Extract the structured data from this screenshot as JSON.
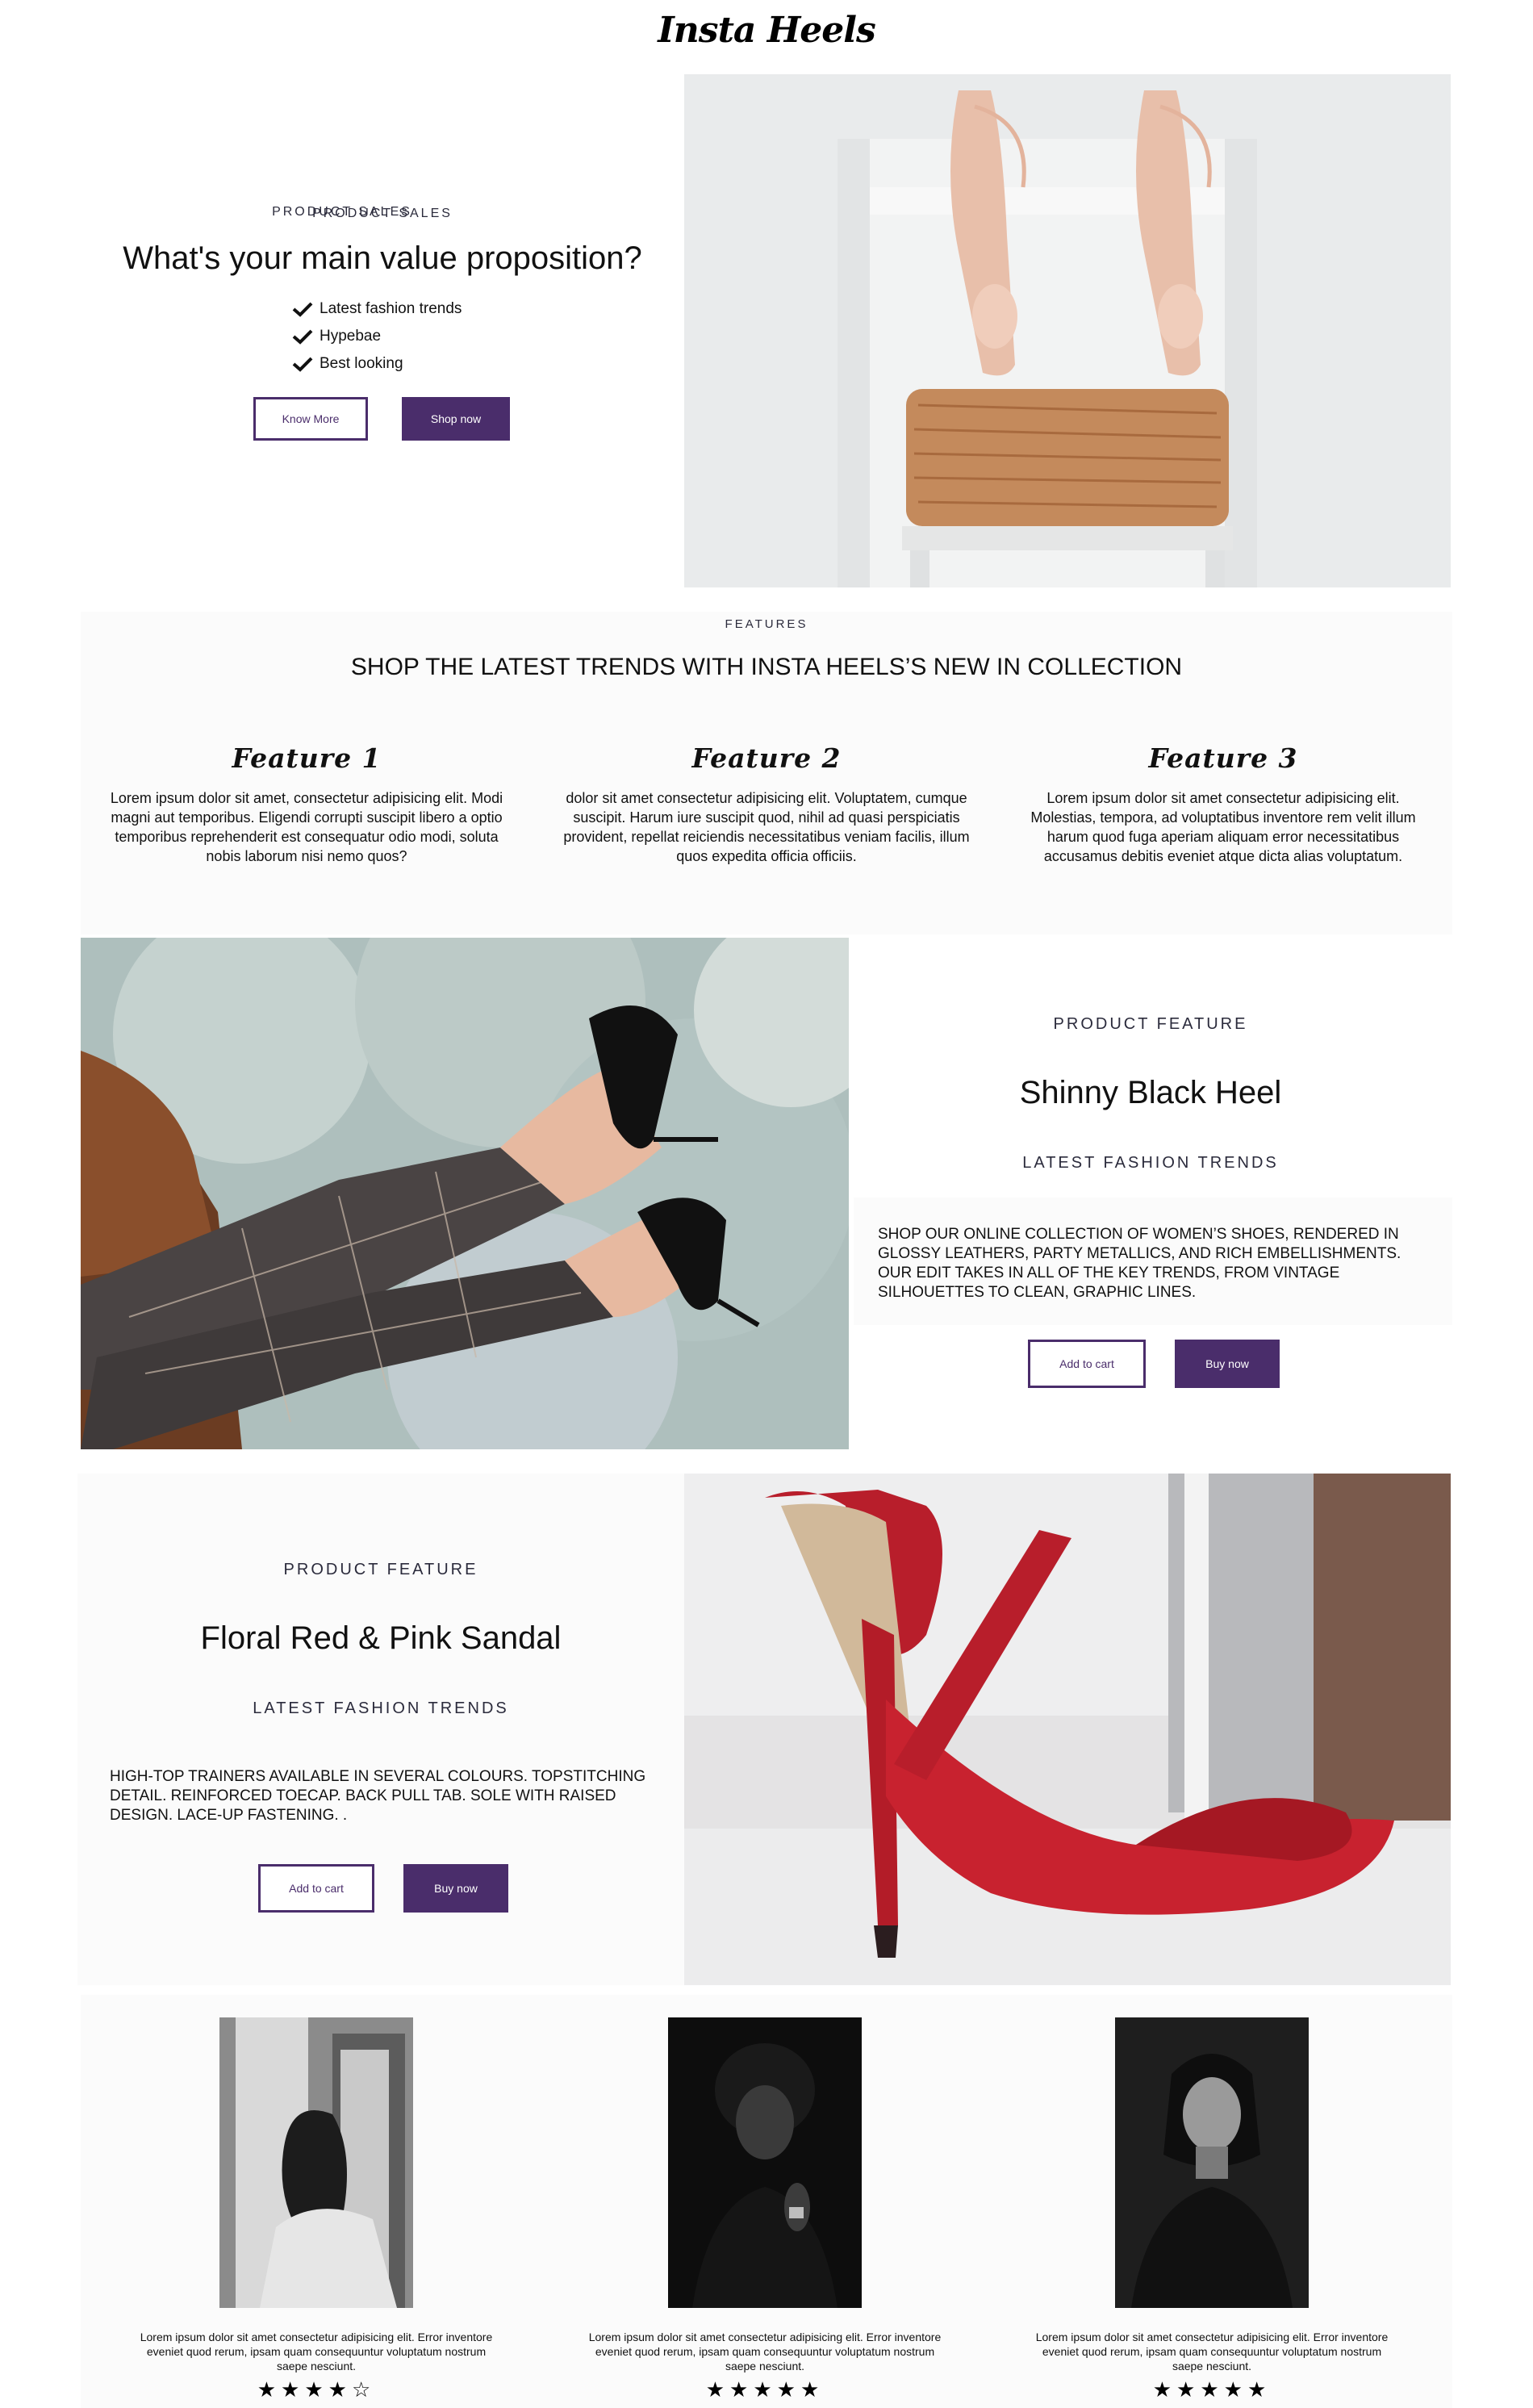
{
  "brand": "Insta Heels",
  "hero": {
    "eyebrow": "PRODUCT SALES",
    "title": "What's your main value proposition?",
    "bullets": [
      "Latest fashion trends",
      "Hypebae",
      "Best looking"
    ],
    "know_more": "Know More",
    "shop_now": "Shop now"
  },
  "features": {
    "eyebrow": "FEATURES",
    "title": "SHOP THE LATEST TRENDS WITH INSTA HEELS’S NEW IN COLLECTION",
    "items": [
      {
        "name": "Feature 1",
        "text": "Lorem ipsum dolor sit amet, consectetur adipisicing elit. Modi magni aut temporibus. Eligendi corrupti suscipit libero a optio temporibus reprehenderit est consequatur odio modi, soluta nobis laborum nisi nemo quos?"
      },
      {
        "name": "Feature 2",
        "text": "dolor sit amet consectetur adipisicing elit. Voluptatem, cumque suscipit. Harum iure suscipit quod, nihil ad quasi perspiciatis provident, repellat reiciendis necessitatibus veniam facilis, illum quos expedita officia officiis."
      },
      {
        "name": "Feature 3",
        "text": "Lorem ipsum dolor sit amet consectetur adipisicing elit. Molestias, tempora, ad voluptatibus inventore rem velit illum harum quod fuga aperiam aliquam error necessitatibus accusamus debitis eveniet atque dicta alias voluptatum."
      }
    ]
  },
  "product1": {
    "eyebrow": "PRODUCT FEATURE",
    "title": "Shinny Black Heel",
    "subtitle": "LATEST FASHION TRENDS",
    "description": "SHOP OUR ONLINE COLLECTION OF WOMEN’S SHOES, RENDERED IN GLOSSY LEATHERS, PARTY METALLICS, AND RICH EMBELLISHMENTS. OUR EDIT TAKES IN ALL OF THE KEY TRENDS, FROM VINTAGE SILHOUETTES TO CLEAN, GRAPHIC LINES.",
    "add_to_cart": "Add to cart",
    "buy_now": "Buy now"
  },
  "product2": {
    "eyebrow": "PRODUCT FEATURE",
    "title": "Floral Red & Pink Sandal",
    "subtitle": "LATEST FASHION TRENDS",
    "description": "HIGH-TOP TRAINERS AVAILABLE IN SEVERAL COLOURS. TOPSTITCHING DETAIL. REINFORCED TOECAP. BACK PULL TAB. SOLE WITH RAISED DESIGN. LACE-UP FASTENING. .",
    "add_to_cart": "Add to cart",
    "buy_now": "Buy now"
  },
  "testimonials": [
    {
      "text": "Lorem ipsum dolor sit amet consectetur adipisicing elit. Error inventore eveniet quod rerum, ipsam quam consequuntur voluptatum nostrum saepe nesciunt.",
      "stars": "★★★★☆",
      "rating": 4
    },
    {
      "text": "Lorem ipsum dolor sit amet consectetur adipisicing elit. Error inventore eveniet quod rerum, ipsam quam consequuntur voluptatum nostrum saepe nesciunt.",
      "stars": "★★★★★",
      "rating": 5
    },
    {
      "text": "Lorem ipsum dolor sit amet consectetur adipisicing elit. Error inventore eveniet quod rerum, ipsam quam consequuntur voluptatum nostrum saepe nesciunt.",
      "stars": "★★★★★",
      "rating": 5
    }
  ],
  "colors": {
    "accent": "#4a2d6b",
    "panel": "#fbfbfb",
    "text": "#111111"
  }
}
